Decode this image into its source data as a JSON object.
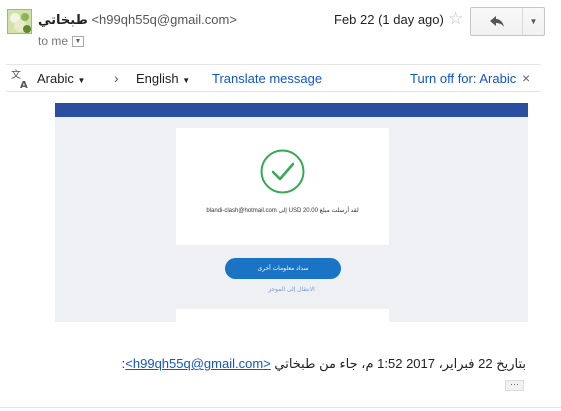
{
  "header": {
    "sender_name": "طبخاتي",
    "sender_email": "<h99qh55q@gmail.com>",
    "recipient": "to me",
    "date": "Feb 22 (1 day ago)"
  },
  "translate_bar": {
    "source_language": "Arabic",
    "target_language": "English",
    "translate_link": "Translate message",
    "turn_off_link": "Turn off for: Arabic"
  },
  "embedded": {
    "confirmation_text": "لقد أرسلت مبلغ 20.00 USD إلى blandi-clash@hotmail.com",
    "button_label": "سداد معلومات أخرى",
    "link_label": "الانتقال إلى الموجز"
  },
  "quote": {
    "prefix": "بتاريخ 22 فبراير، 2017 1:52 م، جاء من طبخاتي ",
    "email": "<h99qh55q@gmail.com>",
    "suffix": ":"
  },
  "icons": [
    "avatar",
    "star-icon",
    "reply-icon",
    "chevron-down-icon",
    "translate-icon",
    "chevron-right-icon",
    "close-icon",
    "check-icon"
  ],
  "colors": {
    "link": "#1155cc",
    "embed_header": "#2b4fa0",
    "embed_button": "#1a73c4",
    "check": "#34a853"
  }
}
